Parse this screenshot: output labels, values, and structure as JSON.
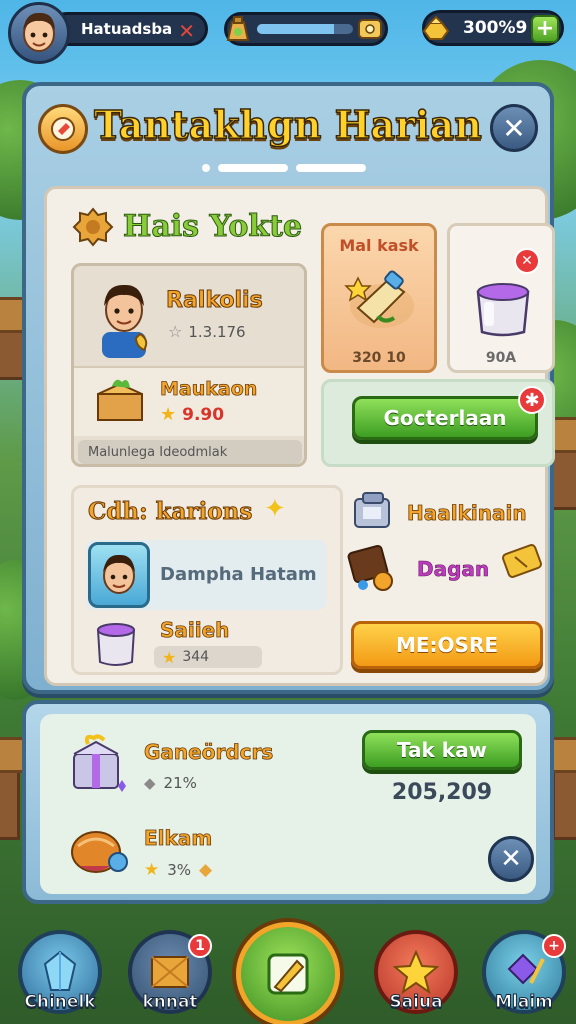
{
  "topbar": {
    "player_name": "Hatuadsba",
    "xp_progress": 0.8,
    "gold_value": "300%9"
  },
  "panel": {
    "title": "Tantakhgn Harian",
    "page_index": 1,
    "page_count": 3
  },
  "daily_section": {
    "title": "Hais Yokte",
    "character_name": "Ralkolis",
    "character_stat": "1.3.176",
    "reward_name": "Maukaon",
    "reward_value": "9.90",
    "footer_text": "Malunlega Ideodmlak",
    "offer_card": {
      "title": "Mal kask",
      "value": "320 10"
    },
    "potion_card": {
      "value": "90A"
    },
    "collect_button": "Gocterlaan"
  },
  "characters_section": {
    "title": "Cdh: karions",
    "hero_name": "Dampha Hatam",
    "item_name": "Saiieh",
    "item_value": "344",
    "right_title": "Haalkinain",
    "right_subtitle": "Dagan",
    "more_button": "ME:OSRE"
  },
  "lower_panel": {
    "item1_name": "Ganeördcrs",
    "item1_value": "21%",
    "item2_name": "Elkam",
    "item2_value": "3%",
    "take_button": "Tak kaw",
    "total_value": "205,209"
  },
  "bottom_nav": [
    {
      "label": "Chinelk",
      "badge": ""
    },
    {
      "label": "knnat",
      "badge": "1"
    },
    {
      "label": "",
      "badge": ""
    },
    {
      "label": "Saiua",
      "badge": ""
    },
    {
      "label": "Mlaim",
      "badge": "+"
    }
  ],
  "colors": {
    "title_gold": "#ffd12a",
    "panel_blue": "#3d6786",
    "button_green": "#3d9e22",
    "button_orange": "#f39a15",
    "alert_red": "#e83a3a"
  }
}
